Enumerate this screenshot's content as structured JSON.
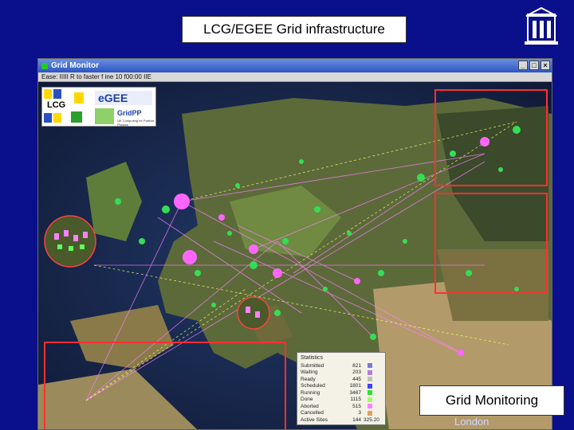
{
  "slide": {
    "title": "LCG/EGEE Grid infrastructure",
    "caption": "Grid Monitoring",
    "footer": "London"
  },
  "window": {
    "title": "Grid Monitor",
    "menu_text": "Ease: IIIII R to faster f ine 10 f00:00 IIE"
  },
  "logos": {
    "lcg": "LCG",
    "egee": "eGEE",
    "gridpp": "GridPP",
    "gridpp_tagline": "UK Computing for Particle Physics"
  },
  "stats": {
    "title": "Statistics",
    "rows": [
      {
        "label": "Submitted",
        "value": "821",
        "color": "#7a7ad8"
      },
      {
        "label": "Waiting",
        "value": "203",
        "color": "#b080e0"
      },
      {
        "label": "Ready",
        "value": "445",
        "color": "#c0c0c0"
      },
      {
        "label": "Scheduled",
        "value": "1801",
        "color": "#4040ff"
      },
      {
        "label": "Running",
        "value": "3467",
        "color": "#30e030"
      },
      {
        "label": "Done",
        "value": "1115",
        "color": "#a0ff60"
      },
      {
        "label": "Aborted",
        "value": "515",
        "color": "#ff80ff"
      },
      {
        "label": "Cancelled",
        "value": "3",
        "color": "#e0a060"
      },
      {
        "label": "Active Sites",
        "value": "144",
        "extra": "325.20",
        "color": "#ffb0ff"
      }
    ]
  }
}
